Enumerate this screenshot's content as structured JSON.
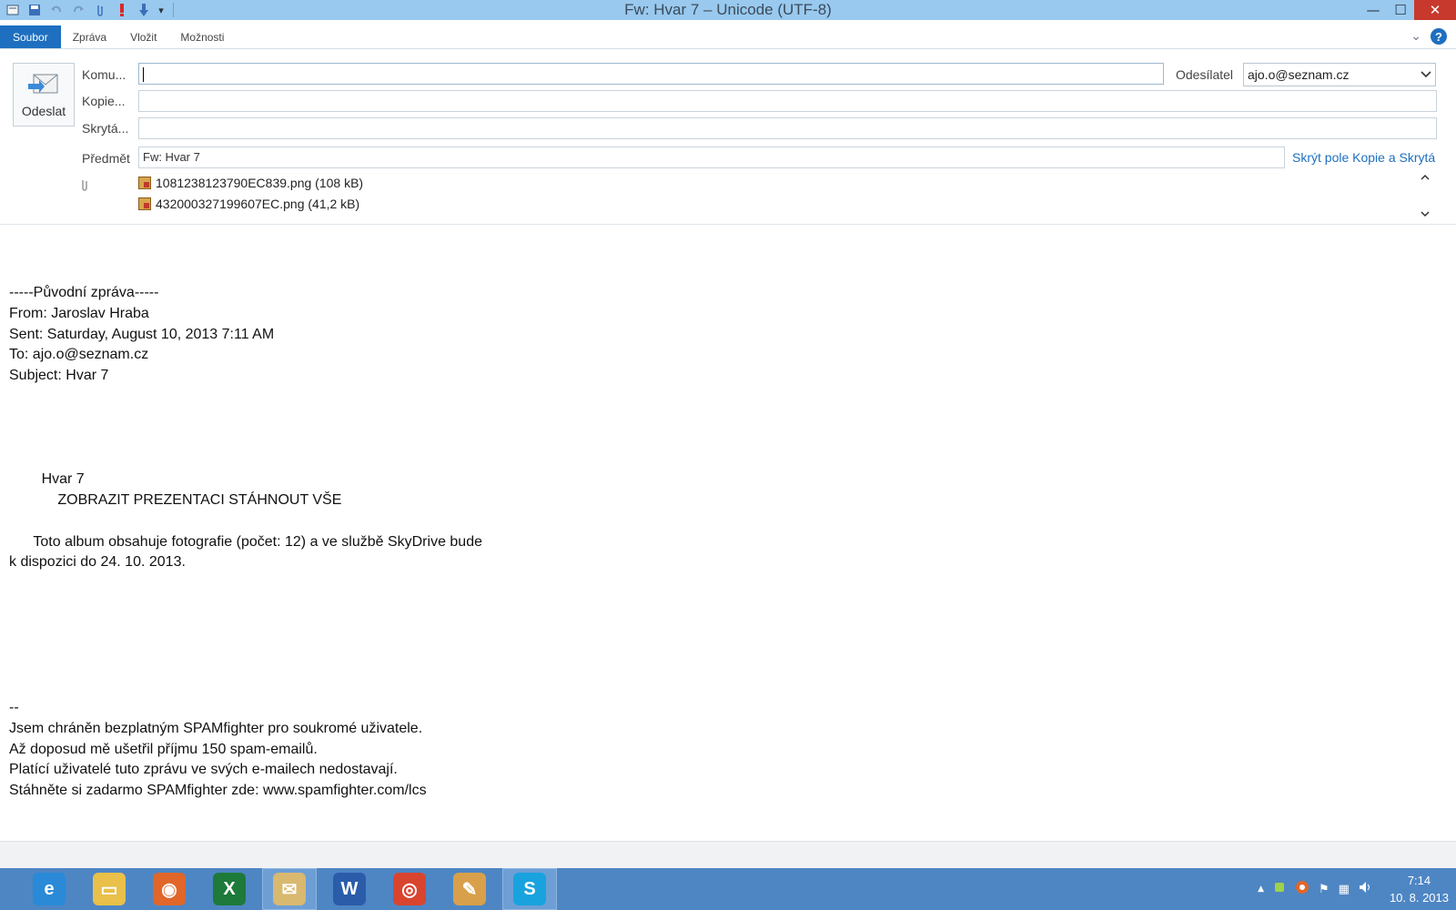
{
  "window": {
    "title": "Fw:  Hvar 7 – Unicode (UTF-8)",
    "minimize_glyph": "—",
    "maximize_glyph": "☐",
    "close_glyph": "✕"
  },
  "quick_access": {
    "dropdown_glyph": "▾"
  },
  "ribbon": {
    "tabs": [
      "Soubor",
      "Zpráva",
      "Vložit",
      "Možnosti"
    ],
    "active_tab": "Soubor",
    "collapse_glyph": "⌄",
    "help_glyph": "?"
  },
  "compose": {
    "send_label": "Odeslat",
    "to_label": "Komu...",
    "to_value": "",
    "cc_label": "Kopie...",
    "cc_value": "",
    "bcc_label": "Skrytá...",
    "bcc_value": "",
    "sender_label": "Odesílatel",
    "sender_value": "ajo.o@seznam.cz",
    "subject_label": "Předmět",
    "subject_value": "Fw:  Hvar 7",
    "hide_fields_link": "Skrýt pole Kopie a Skrytá",
    "attachments": [
      {
        "name": "1081238123790EC839.png (108 kB)"
      },
      {
        "name": "432000327199607EC.png (41,2 kB)"
      }
    ]
  },
  "body_lines": [
    "-----Původní zpráva-----",
    "From: Jaroslav Hraba",
    "Sent: Saturday, August 10, 2013 7:11 AM",
    "To: ajo.o@seznam.cz",
    "Subject: Hvar 7",
    "",
    "",
    "",
    "",
    "        Hvar 7",
    "            ZOBRAZIT PREZENTACI STÁHNOUT VŠE",
    "",
    "      Toto album obsahuje fotografie (počet: 12) a ve službě SkyDrive bude",
    "k dispozici do 24. 10. 2013.",
    "",
    "",
    "",
    "",
    "",
    "",
    "--",
    "Jsem chráněn bezplatným SPAMfighter pro soukromé uživatele.",
    "Až doposud mě ušetřil příjmu 150 spam-emailů.",
    "Platící uživatelé tuto zprávu ve svých e-mailech nedostavají.",
    "Stáhněte si zadarmo SPAMfighter zde: www.spamfighter.com/lcs"
  ],
  "taskbar": {
    "apps": [
      {
        "name": "internet-explorer",
        "glyph": "e",
        "color": "#2a8ad8",
        "active": false
      },
      {
        "name": "file-explorer",
        "glyph": "▭",
        "color": "#e8c04a",
        "active": false
      },
      {
        "name": "firefox",
        "glyph": "◉",
        "color": "#e0662a",
        "active": false
      },
      {
        "name": "excel",
        "glyph": "X",
        "color": "#1d7a3a",
        "active": false
      },
      {
        "name": "windows-live-mail",
        "glyph": "✉",
        "color": "#d9b870",
        "active": true
      },
      {
        "name": "word",
        "glyph": "W",
        "color": "#2a5caa",
        "active": false
      },
      {
        "name": "chrome",
        "glyph": "◎",
        "color": "#d9442f",
        "active": false
      },
      {
        "name": "paint",
        "glyph": "✎",
        "color": "#d8a04a",
        "active": false
      },
      {
        "name": "skype",
        "glyph": "S",
        "color": "#18a3de",
        "active": true
      }
    ],
    "tray_glyphs": {
      "up": "▲",
      "flag": "⚑",
      "network": "▦",
      "volume": "🔊"
    },
    "time": "7:14",
    "date": "10. 8. 2013"
  }
}
